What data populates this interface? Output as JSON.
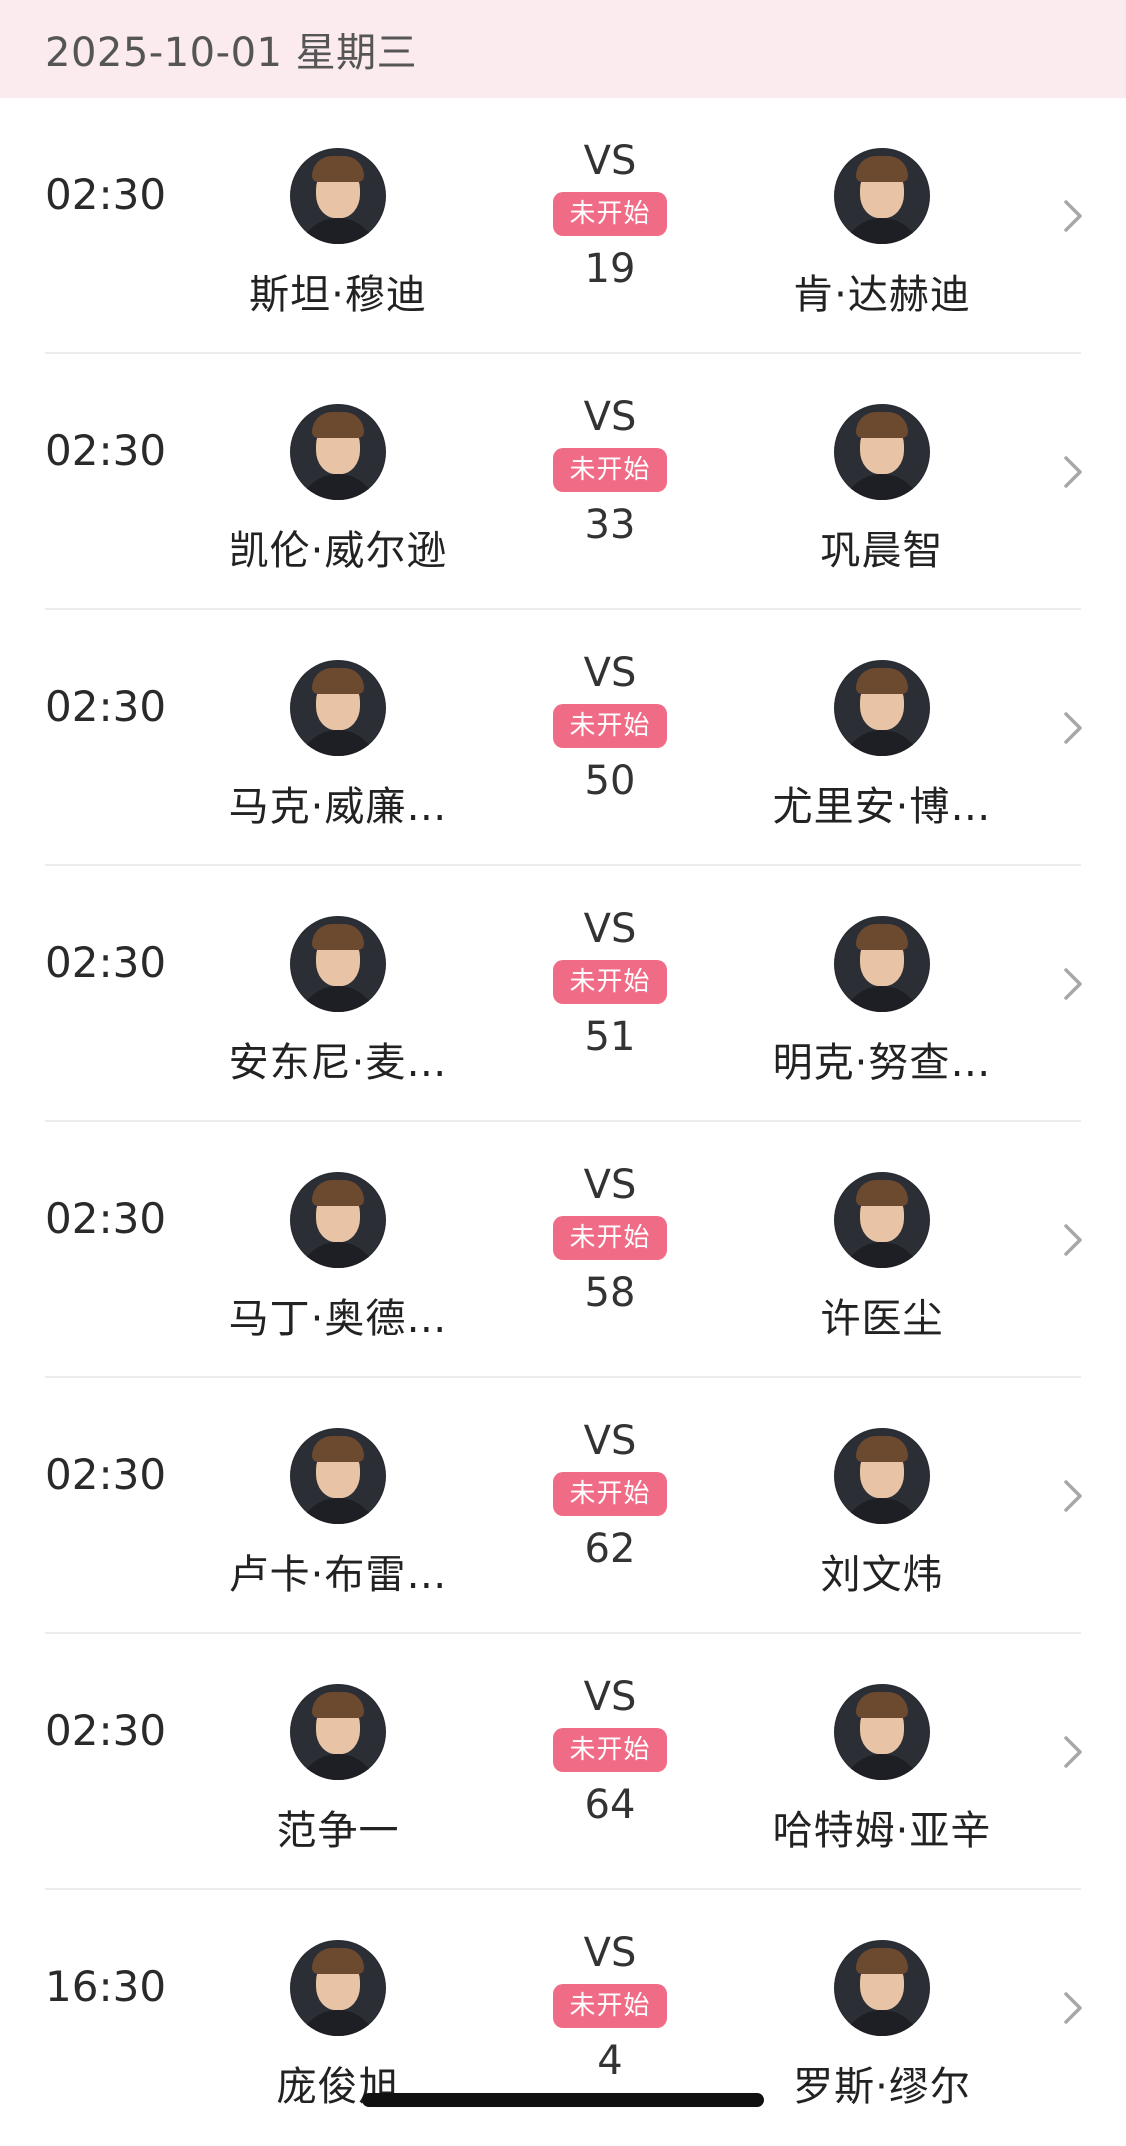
{
  "header": {
    "date": "2025-10-01 星期三"
  },
  "colors": {
    "header_bg": "#fbeaee",
    "badge_bg": "#f06b86",
    "divider": "#ececec"
  },
  "icons": {
    "row_action": "chevron-right-icon",
    "avatar": "player-avatar-icon"
  },
  "matches": [
    {
      "time": "02:30",
      "left_player": "斯坦·穆迪",
      "vs": "VS",
      "status": "未开始",
      "match_number": "19",
      "right_player": "肯·达赫迪"
    },
    {
      "time": "02:30",
      "left_player": "凯伦·威尔逊",
      "vs": "VS",
      "status": "未开始",
      "match_number": "33",
      "right_player": "巩晨智"
    },
    {
      "time": "02:30",
      "left_player": "马克·威廉…",
      "vs": "VS",
      "status": "未开始",
      "match_number": "50",
      "right_player": "尤里安·博…"
    },
    {
      "time": "02:30",
      "left_player": "安东尼·麦…",
      "vs": "VS",
      "status": "未开始",
      "match_number": "51",
      "right_player": "明克·努查…"
    },
    {
      "time": "02:30",
      "left_player": "马丁·奥德…",
      "vs": "VS",
      "status": "未开始",
      "match_number": "58",
      "right_player": "许医尘"
    },
    {
      "time": "02:30",
      "left_player": "卢卡·布雷…",
      "vs": "VS",
      "status": "未开始",
      "match_number": "62",
      "right_player": "刘文炜"
    },
    {
      "time": "02:30",
      "left_player": "范争一",
      "vs": "VS",
      "status": "未开始",
      "match_number": "64",
      "right_player": "哈特姆·亚辛"
    },
    {
      "time": "16:30",
      "left_player": "庞俊旭",
      "vs": "VS",
      "status": "未开始",
      "match_number": "4",
      "right_player": "罗斯·缪尔"
    }
  ]
}
